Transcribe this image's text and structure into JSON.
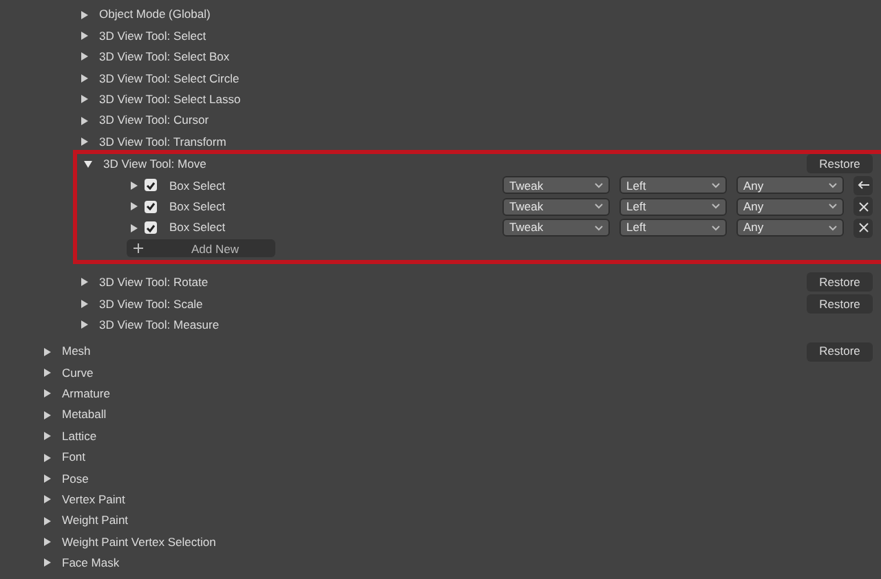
{
  "tool_items": [
    {
      "label": "Object Mode (Global)",
      "expanded": false
    },
    {
      "label": "3D View Tool: Select",
      "expanded": false
    },
    {
      "label": "3D View Tool: Select Box",
      "expanded": false
    },
    {
      "label": "3D View Tool: Select Circle",
      "expanded": false
    },
    {
      "label": "3D View Tool: Select Lasso",
      "expanded": false
    },
    {
      "label": "3D View Tool: Cursor",
      "expanded": false
    },
    {
      "label": "3D View Tool: Transform",
      "expanded": false
    },
    {
      "label": "3D View Tool: Move",
      "expanded": true,
      "restore": "Restore",
      "highlighted": true,
      "entries": [
        {
          "name": "Box Select",
          "checked": true,
          "expanded": false,
          "event": "Tweak",
          "button": "Left",
          "modifier": "Any",
          "kind": "restore"
        },
        {
          "name": "Box Select",
          "checked": true,
          "expanded": false,
          "event": "Tweak",
          "button": "Left",
          "modifier": "Any",
          "kind": "remove"
        },
        {
          "name": "Box Select",
          "checked": true,
          "expanded": false,
          "event": "Tweak",
          "button": "Left",
          "modifier": "Any",
          "kind": "remove"
        }
      ],
      "add_new": "Add New"
    },
    {
      "label": "3D View Tool: Rotate",
      "expanded": false,
      "restore": "Restore"
    },
    {
      "label": "3D View Tool: Scale",
      "expanded": false,
      "restore": "Restore"
    },
    {
      "label": "3D View Tool: Measure",
      "expanded": false
    }
  ],
  "categories": [
    {
      "label": "Mesh",
      "expanded": false,
      "restore": "Restore"
    },
    {
      "label": "Curve",
      "expanded": false
    },
    {
      "label": "Armature",
      "expanded": false
    },
    {
      "label": "Metaball",
      "expanded": false
    },
    {
      "label": "Lattice",
      "expanded": false
    },
    {
      "label": "Font",
      "expanded": false
    },
    {
      "label": "Pose",
      "expanded": false
    },
    {
      "label": "Vertex Paint",
      "expanded": false
    },
    {
      "label": "Weight Paint",
      "expanded": false
    },
    {
      "label": "Weight Paint Vertex Selection",
      "expanded": false
    },
    {
      "label": "Face Mask",
      "expanded": false
    }
  ]
}
